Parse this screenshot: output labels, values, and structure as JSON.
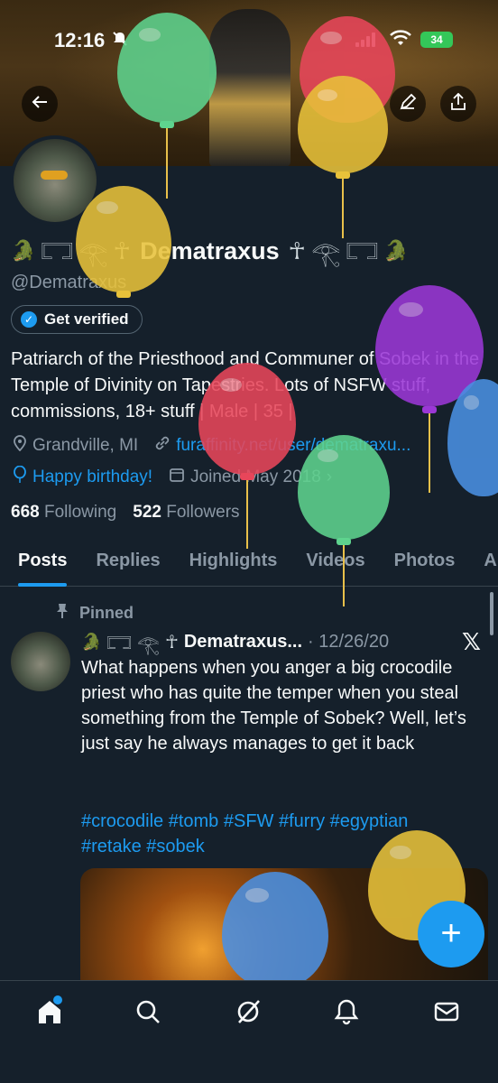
{
  "status": {
    "time": "12:16",
    "battery": "34"
  },
  "profile": {
    "name": "Dematraxus",
    "handle": "@Dematraxus",
    "verified_button": "Get verified",
    "bio": "Patriarch of the Priesthood and Communer of Sobek in the Temple of Divinity on Tapestries. Lots of NSFW stuff, commissions, 18+ stuff | Male | 35 |",
    "location": "Grandville, MI",
    "website": "furaffinity.net/user/dematraxu...",
    "birthday": "Happy birthday!",
    "joined": "Joined May 2018",
    "following_count": "668",
    "following_label": "Following",
    "followers_count": "522",
    "followers_label": "Followers"
  },
  "tabs": [
    "Posts",
    "Replies",
    "Highlights",
    "Videos",
    "Photos",
    "A"
  ],
  "post": {
    "pinned_label": "Pinned",
    "author": "Dematraxus...",
    "date": "· 12/26/20",
    "text": "What happens when you anger a big crocodile priest who has quite the temper when you steal something from the Temple of Sobek? Well, let’s just say he always manages to get it back",
    "hashtags_line1": "#crocodile #tomb #SFW #furry #egyptian",
    "hashtags_line2": "#retake #sobek"
  },
  "icons": {
    "back": "back-arrow-icon",
    "edit": "edit-icon",
    "share": "share-icon",
    "home": "home-icon",
    "search": "search-icon",
    "grok": "grok-icon",
    "notifications": "bell-icon",
    "messages": "mail-icon"
  },
  "colors": {
    "accent": "#1d9bf0",
    "background": "#15202b",
    "muted": "#8b98a5"
  }
}
